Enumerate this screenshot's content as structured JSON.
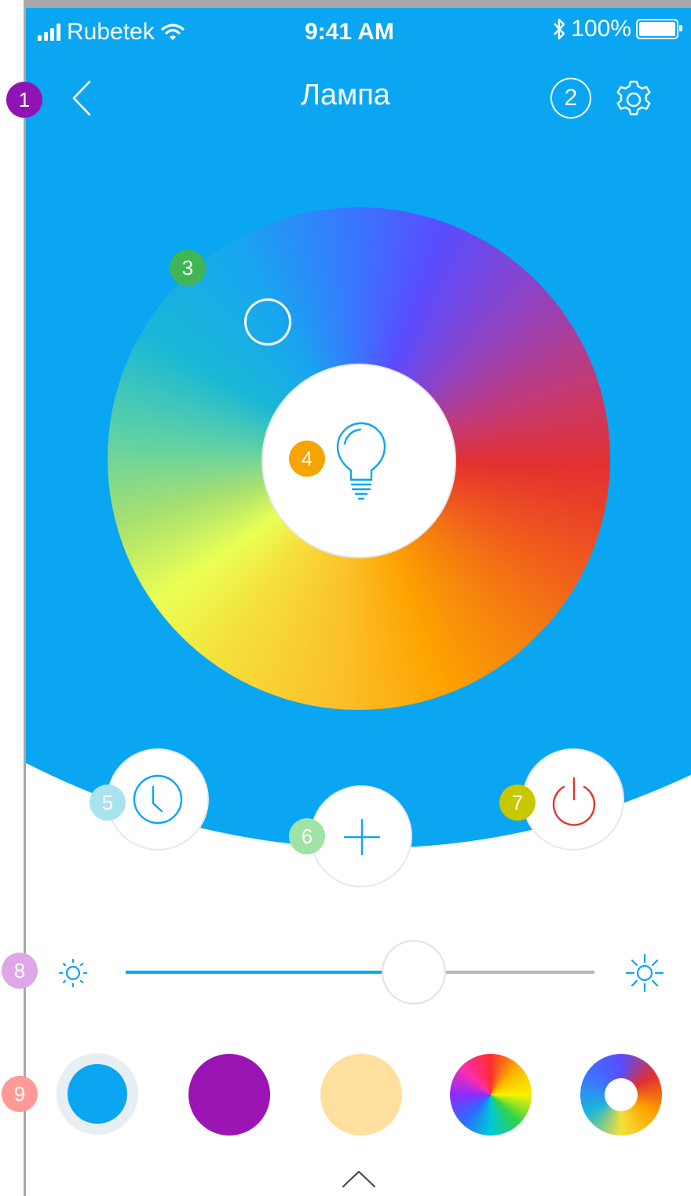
{
  "status_bar": {
    "carrier": "Rubetek",
    "time": "9:41 AM",
    "battery": "100%",
    "icons": [
      "signal-icon",
      "wifi-icon",
      "bluetooth-icon",
      "battery-icon"
    ]
  },
  "header": {
    "title": "Лампа",
    "badge_count": "2",
    "icons": [
      "chevron-left-icon",
      "gear-icon"
    ]
  },
  "annotations": {
    "m1": "1",
    "m3": "3",
    "m4": "4",
    "m5": "5",
    "m6": "6",
    "m7": "7",
    "m8": "8",
    "m9": "9"
  },
  "controls": {
    "icons": [
      "lightbulb-icon",
      "clock-icon",
      "plus-icon",
      "power-icon",
      "sun-small-icon",
      "sun-large-icon",
      "chevron-up-icon"
    ]
  },
  "brightness": {
    "value_fraction": 0.62
  },
  "presets": [
    {
      "name": "blue",
      "color": "#0aa6f2",
      "selected": true
    },
    {
      "name": "purple",
      "color": "#9b14b4"
    },
    {
      "name": "warm",
      "color": "#ffdf9e"
    },
    {
      "name": "color-wheel",
      "color": "multi"
    },
    {
      "name": "color-ring",
      "color": "multi"
    }
  ],
  "colors": {
    "accent": "#0aa6f2",
    "marker1": "#8f14b4",
    "marker3": "#40b554",
    "marker4": "#f5a400",
    "marker5": "#a9e3ee",
    "marker6": "#9fe3a5",
    "marker7": "#c8c800",
    "marker8": "#dda7e8",
    "marker9": "#ff9a96",
    "power": "#e5322f"
  }
}
